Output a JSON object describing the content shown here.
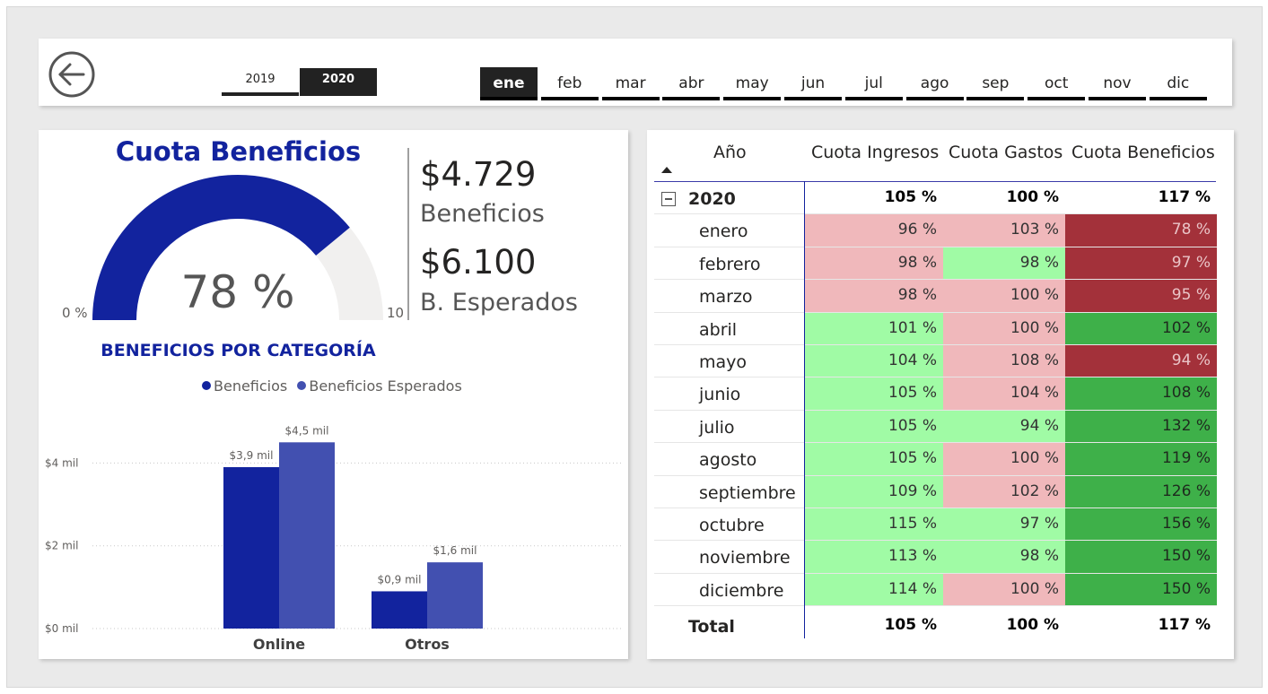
{
  "filters": {
    "years": [
      "2019",
      "2020"
    ],
    "selected_year": "2020",
    "months": [
      "ene",
      "feb",
      "mar",
      "abr",
      "may",
      "jun",
      "jul",
      "ago",
      "sep",
      "oct",
      "nov",
      "dic"
    ],
    "selected_month": "ene"
  },
  "gauge": {
    "title": "Cuota Beneficios",
    "value_label": "78 %",
    "value": 0.78,
    "min_label": "0 %",
    "max_label_clipped": "10",
    "fill_color": "#12239e",
    "track_color": "#f1f0ef"
  },
  "kpis": [
    {
      "value": "$4.729",
      "label": "Beneficios"
    },
    {
      "value": "$6.100",
      "label": "B. Esperados"
    }
  ],
  "category_chart": {
    "title": "BENEFICIOS POR CATEGORÍA",
    "legend": [
      "Beneficios",
      "Beneficios Esperados"
    ],
    "colors": [
      "#12239e",
      "#4250b0"
    ]
  },
  "chart_data": {
    "type": "bar",
    "title": "BENEFICIOS POR CATEGORÍA",
    "categories": [
      "Online",
      "Otros"
    ],
    "series": [
      {
        "name": "Beneficios",
        "values": [
          3.9,
          0.9
        ],
        "labels": [
          "$3,9 mil",
          "$0,9 mil"
        ]
      },
      {
        "name": "Beneficios Esperados",
        "values": [
          4.5,
          1.6
        ],
        "labels": [
          "$4,5 mil",
          "$1,6 mil"
        ]
      }
    ],
    "y_ticks": [
      0,
      2,
      4
    ],
    "y_tick_labels": [
      "$0 mil",
      "$2 mil",
      "$4 mil"
    ],
    "ylim": [
      0,
      5.2
    ],
    "legend_position": "top",
    "grid": true
  },
  "matrix": {
    "headers": [
      "Año",
      "Cuota Ingresos",
      "Cuota Gastos",
      "Cuota Beneficios"
    ],
    "year_row": {
      "label": "2020",
      "values": [
        "105 %",
        "100 %",
        "117 %"
      ]
    },
    "rows": [
      {
        "label": "enero",
        "values": [
          "96 %",
          "103 %",
          "78 %"
        ],
        "status": [
          "low",
          "low",
          "bad"
        ]
      },
      {
        "label": "febrero",
        "values": [
          "98 %",
          "98 %",
          "97 %"
        ],
        "status": [
          "low",
          "ok",
          "bad"
        ]
      },
      {
        "label": "marzo",
        "values": [
          "98 %",
          "100 %",
          "95 %"
        ],
        "status": [
          "low",
          "low",
          "bad"
        ]
      },
      {
        "label": "abril",
        "values": [
          "101 %",
          "100 %",
          "102 %"
        ],
        "status": [
          "ok",
          "low",
          "good"
        ]
      },
      {
        "label": "mayo",
        "values": [
          "104 %",
          "108 %",
          "94 %"
        ],
        "status": [
          "ok",
          "low",
          "bad"
        ]
      },
      {
        "label": "junio",
        "values": [
          "105 %",
          "104 %",
          "108 %"
        ],
        "status": [
          "ok",
          "low",
          "good"
        ]
      },
      {
        "label": "julio",
        "values": [
          "105 %",
          "94 %",
          "132 %"
        ],
        "status": [
          "ok",
          "ok",
          "good"
        ]
      },
      {
        "label": "agosto",
        "values": [
          "105 %",
          "100 %",
          "119 %"
        ],
        "status": [
          "ok",
          "low",
          "good"
        ]
      },
      {
        "label": "septiembre",
        "values": [
          "109 %",
          "102 %",
          "126 %"
        ],
        "status": [
          "ok",
          "low",
          "good"
        ]
      },
      {
        "label": "octubre",
        "values": [
          "115 %",
          "97 %",
          "156 %"
        ],
        "status": [
          "ok",
          "ok",
          "good"
        ]
      },
      {
        "label": "noviembre",
        "values": [
          "113 %",
          "98 %",
          "150 %"
        ],
        "status": [
          "ok",
          "ok",
          "good"
        ]
      },
      {
        "label": "diciembre",
        "values": [
          "114 %",
          "100 %",
          "150 %"
        ],
        "status": [
          "ok",
          "low",
          "good"
        ]
      }
    ],
    "total_row": {
      "label": "Total",
      "values": [
        "105 %",
        "100 %",
        "117 %"
      ]
    },
    "status_colors": {
      "low": "#f0b8bb",
      "ok": "#a0fba5",
      "bad": "#a3313a",
      "good": "#3eb049"
    }
  }
}
